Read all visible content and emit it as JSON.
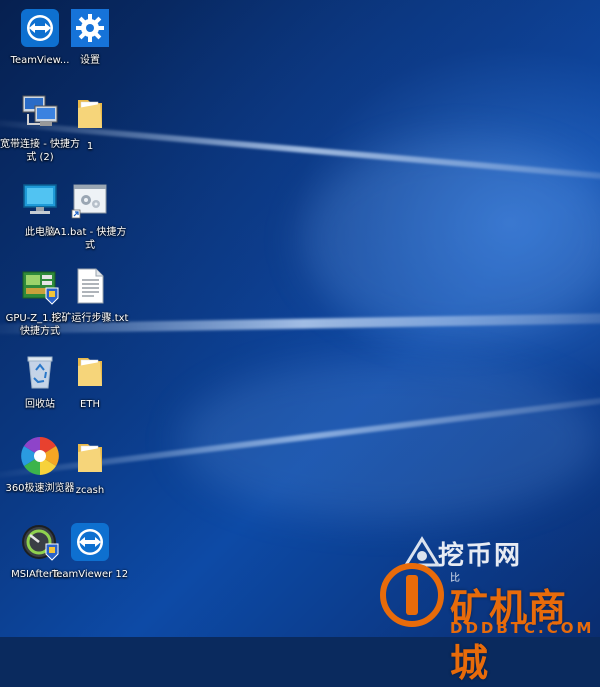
{
  "desktop": {
    "icons": [
      {
        "id": "teamviewer",
        "label": "TeamView..."
      },
      {
        "id": "settings",
        "label": "设置"
      },
      {
        "id": "broadband",
        "label": "宽带连接 - 快捷方式 (2)"
      },
      {
        "id": "folder-1",
        "label": "1"
      },
      {
        "id": "this-pc",
        "label": "此电脑"
      },
      {
        "id": "a1-bat",
        "label": "A1.bat - 快捷方式"
      },
      {
        "id": "gpuz",
        "label": "GPU-Z_1.9... - 快捷方式"
      },
      {
        "id": "mining-txt",
        "label": "挖矿运行步骤.txt"
      },
      {
        "id": "recycle-bin",
        "label": "回收站"
      },
      {
        "id": "eth",
        "label": "ETH"
      },
      {
        "id": "browser-360",
        "label": "360极速浏览器"
      },
      {
        "id": "zcash",
        "label": "zcash"
      },
      {
        "id": "msi-afterburner",
        "label": "MSIAfterb..."
      },
      {
        "id": "teamviewer12",
        "label": "TeamViewer 12"
      }
    ]
  },
  "watermark": {
    "top": "挖币网",
    "small": "比",
    "big": "矿机商城",
    "url": "DDDBTC.COM"
  },
  "colors": {
    "accent_orange": "#e86b0a",
    "teamviewer_blue": "#0e70d0",
    "settings_blue": "#1673d9"
  }
}
